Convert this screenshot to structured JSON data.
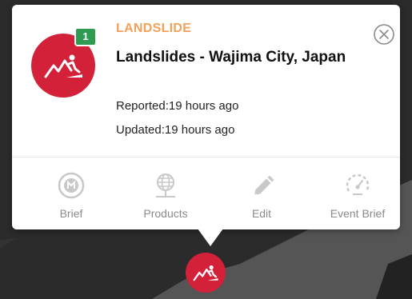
{
  "event": {
    "category": "LANDSLIDE",
    "title": "Landslides - Wajima City, Japan",
    "reported": "Reported:19 hours ago",
    "updated": "Updated:19 hours ago",
    "count": "1",
    "icon": "landslide-icon"
  },
  "actions": [
    {
      "label": "Brief",
      "icon": "brief-icon"
    },
    {
      "label": "Products",
      "icon": "globe-icon"
    },
    {
      "label": "Edit",
      "icon": "pencil-icon"
    },
    {
      "label": "Event Brief",
      "icon": "gauge-icon"
    }
  ],
  "colors": {
    "accent_red": "#d4213a",
    "category_orange": "#f2a05a",
    "badge_green": "#2e9a52",
    "action_gray": "#8a8a8a"
  }
}
